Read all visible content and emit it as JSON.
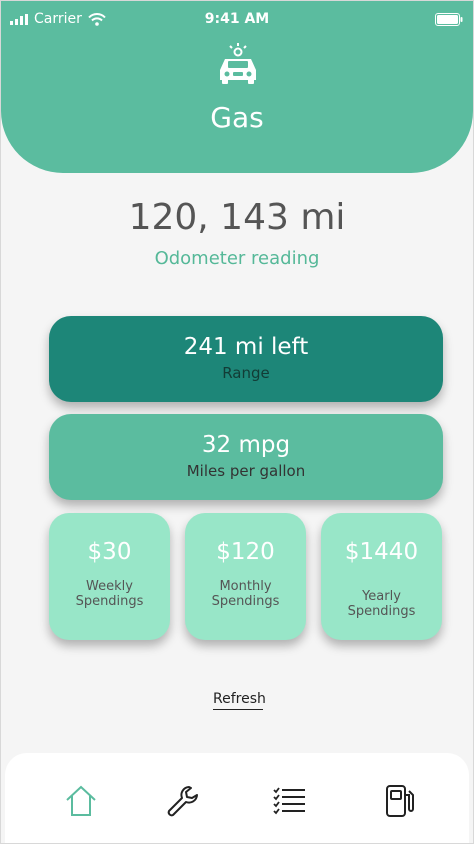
{
  "status_bar": {
    "carrier": "Carrier",
    "time": "9:41 AM"
  },
  "header": {
    "title": "Gas",
    "icon": "car-icon"
  },
  "odometer": {
    "value": "120, 143 mi",
    "label": "Odometer reading"
  },
  "range_card": {
    "value": "241 mi left",
    "label": "Range"
  },
  "mpg_card": {
    "value": "32 mpg",
    "label": "Miles per gallon"
  },
  "spendings": [
    {
      "amount": "$30",
      "label": "Weekly Spendings"
    },
    {
      "amount": "$120",
      "label": "Monthly Spendings"
    },
    {
      "amount": "$1440",
      "label": "Yearly Spendings"
    }
  ],
  "refresh_label": "Refresh",
  "tab_bar": {
    "items": [
      {
        "icon": "home-icon",
        "active": true
      },
      {
        "icon": "wrench-icon",
        "active": false
      },
      {
        "icon": "checklist-icon",
        "active": false
      },
      {
        "icon": "gas-pump-icon",
        "active": false
      }
    ]
  },
  "colors": {
    "primary": "#5bbc9f",
    "dark": "#1d8678",
    "light": "#98e6c8",
    "background": "#f5f5f5"
  }
}
